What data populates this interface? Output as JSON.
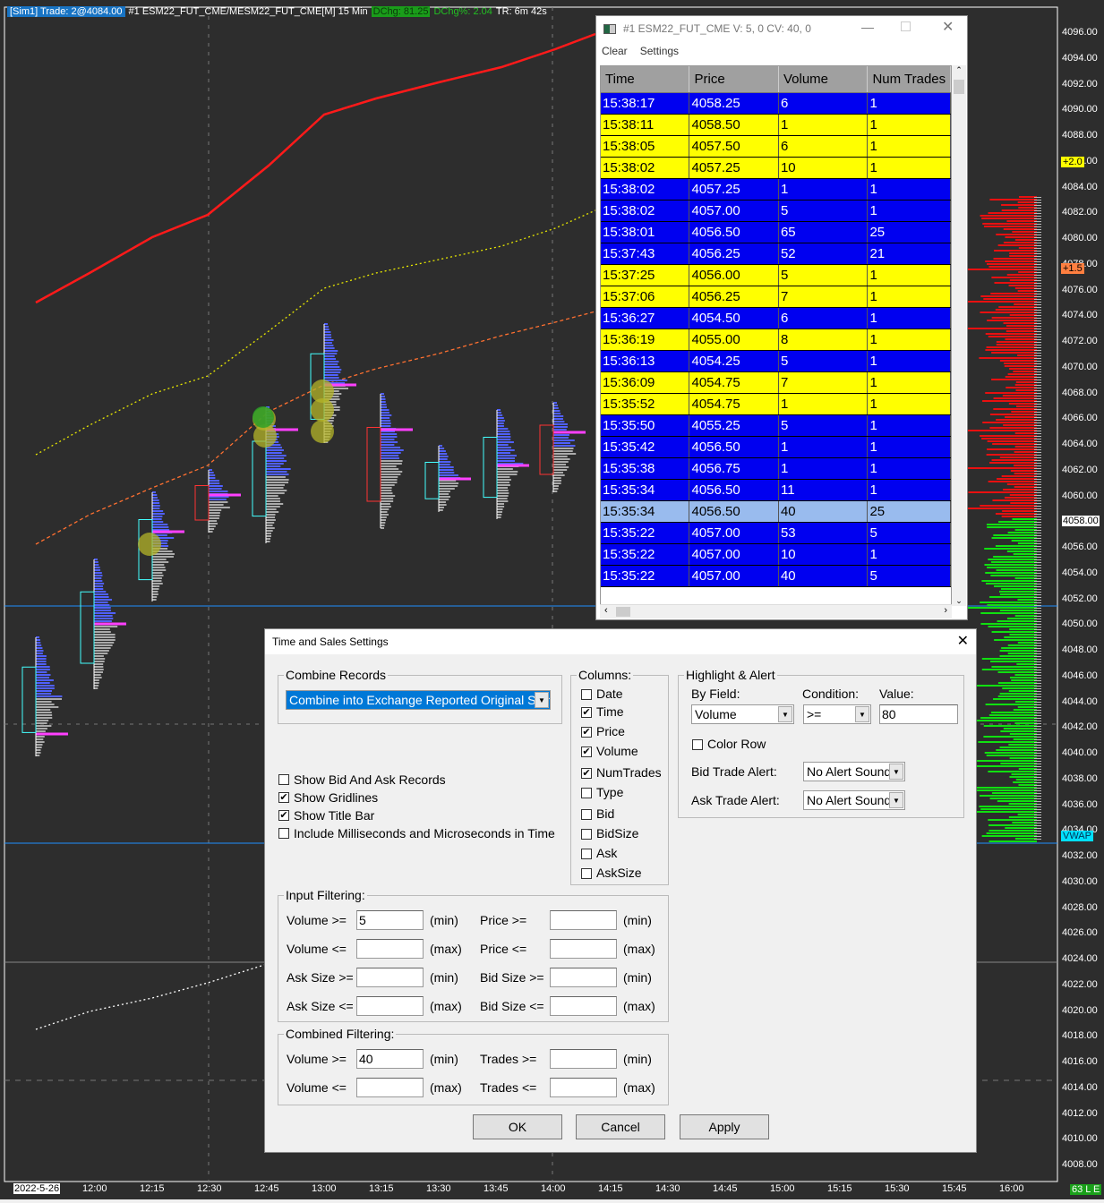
{
  "chart": {
    "header": {
      "sim": "[Sim1]  Trade: 2@4084.00",
      "symbol": "#1 ESM22_FUT_CME/MESM22_FUT_CME[M] 15 Min",
      "dchg": "DChg: 81.25",
      "dchg_pct": "DChg%: 2.04",
      "tr": "TR: 6m 42s"
    },
    "price_labels": [
      "4096.00",
      "4094.00",
      "4092.00",
      "4090.00",
      "4088.00",
      "4086.00",
      "4084.00",
      "4082.00",
      "4080.00",
      "4078.00",
      "4076.00",
      "4074.00",
      "4072.00",
      "4070.00",
      "4068.00",
      "4066.00",
      "4064.00",
      "4062.00",
      "4060.00",
      "4058.00",
      "4056.00",
      "4054.00",
      "4052.00",
      "4050.00",
      "4048.00",
      "4046.00",
      "4044.00",
      "4042.00",
      "4040.00",
      "4038.00",
      "4036.00",
      "4034.00",
      "4032.00",
      "4030.00",
      "4028.00",
      "4026.00",
      "4024.00",
      "4022.00",
      "4020.00",
      "4018.00",
      "4016.00",
      "4014.00",
      "4012.00",
      "4010.00",
      "4008.00"
    ],
    "current_price": "4058.00",
    "badges": {
      "plus2": "+2.0",
      "plus15": "+1.5",
      "vwap": "VWAP",
      "status": "63 L E"
    },
    "time_labels": [
      "2022-5-26",
      "12:00",
      "12:15",
      "12:30",
      "12:45",
      "13:00",
      "13:15",
      "13:30",
      "13:45",
      "14:00",
      "14:15",
      "14:30",
      "14:45",
      "15:00",
      "15:15",
      "15:30",
      "15:45",
      "16:00"
    ],
    "colors": {
      "bg": "#2d2d2d",
      "red": "#ff2020",
      "green": "#20e020",
      "blue": "#1874c4"
    }
  },
  "ts": {
    "title": "#1 ESM22_FUT_CME  V: 5, 0  CV: 40, 0",
    "menu": [
      "Clear",
      "Settings"
    ],
    "columns": [
      "Time",
      "Price",
      "Volume",
      "Num Trades"
    ],
    "rows": [
      {
        "t": "15:38:17",
        "p": "4058.25",
        "v": "6",
        "n": "1",
        "c": "blue"
      },
      {
        "t": "15:38:11",
        "p": "4058.50",
        "v": "1",
        "n": "1",
        "c": "yellow"
      },
      {
        "t": "15:38:05",
        "p": "4057.50",
        "v": "6",
        "n": "1",
        "c": "yellow"
      },
      {
        "t": "15:38:02",
        "p": "4057.25",
        "v": "10",
        "n": "1",
        "c": "yellow"
      },
      {
        "t": "15:38:02",
        "p": "4057.25",
        "v": "1",
        "n": "1",
        "c": "blue"
      },
      {
        "t": "15:38:02",
        "p": "4057.00",
        "v": "5",
        "n": "1",
        "c": "blue"
      },
      {
        "t": "15:38:01",
        "p": "4056.50",
        "v": "65",
        "n": "25",
        "c": "blue"
      },
      {
        "t": "15:37:43",
        "p": "4056.25",
        "v": "52",
        "n": "21",
        "c": "blue"
      },
      {
        "t": "15:37:25",
        "p": "4056.00",
        "v": "5",
        "n": "1",
        "c": "yellow"
      },
      {
        "t": "15:37:06",
        "p": "4056.25",
        "v": "7",
        "n": "1",
        "c": "yellow"
      },
      {
        "t": "15:36:27",
        "p": "4054.50",
        "v": "6",
        "n": "1",
        "c": "blue"
      },
      {
        "t": "15:36:19",
        "p": "4055.00",
        "v": "8",
        "n": "1",
        "c": "yellow"
      },
      {
        "t": "15:36:13",
        "p": "4054.25",
        "v": "5",
        "n": "1",
        "c": "blue"
      },
      {
        "t": "15:36:09",
        "p": "4054.75",
        "v": "7",
        "n": "1",
        "c": "yellow"
      },
      {
        "t": "15:35:52",
        "p": "4054.75",
        "v": "1",
        "n": "1",
        "c": "yellow"
      },
      {
        "t": "15:35:50",
        "p": "4055.25",
        "v": "5",
        "n": "1",
        "c": "blue"
      },
      {
        "t": "15:35:42",
        "p": "4056.50",
        "v": "1",
        "n": "1",
        "c": "blue"
      },
      {
        "t": "15:35:38",
        "p": "4056.75",
        "v": "1",
        "n": "1",
        "c": "blue"
      },
      {
        "t": "15:35:34",
        "p": "4056.50",
        "v": "11",
        "n": "1",
        "c": "blue"
      },
      {
        "t": "15:35:34",
        "p": "4056.50",
        "v": "40",
        "n": "25",
        "c": "sel"
      },
      {
        "t": "15:35:22",
        "p": "4057.00",
        "v": "53",
        "n": "5",
        "c": "blue"
      },
      {
        "t": "15:35:22",
        "p": "4057.00",
        "v": "10",
        "n": "1",
        "c": "blue"
      },
      {
        "t": "15:35:22",
        "p": "4057.00",
        "v": "40",
        "n": "5",
        "c": "blue"
      }
    ]
  },
  "dialog": {
    "title": "Time and Sales Settings",
    "combine": {
      "legend": "Combine Records",
      "value": "Combine into Exchange Reported Original Sum"
    },
    "options": [
      {
        "label": "Show Bid And Ask Records",
        "checked": false
      },
      {
        "label": "Show Gridlines",
        "checked": true
      },
      {
        "label": "Show Title Bar",
        "checked": true
      },
      {
        "label": "Include Milliseconds and Microseconds in Time",
        "checked": false
      }
    ],
    "columns": {
      "legend": "Columns:",
      "items": [
        {
          "label": "Date",
          "checked": false
        },
        {
          "label": "Time",
          "checked": true
        },
        {
          "label": "Price",
          "checked": true
        },
        {
          "label": "Volume",
          "checked": true
        },
        {
          "label": "NumTrades",
          "checked": true
        },
        {
          "label": "Type",
          "checked": false
        },
        {
          "label": "Bid",
          "checked": false
        },
        {
          "label": "BidSize",
          "checked": false
        },
        {
          "label": "Ask",
          "checked": false
        },
        {
          "label": "AskSize",
          "checked": false
        }
      ]
    },
    "highlight": {
      "legend": "Highlight & Alert",
      "by_field_label": "By Field:",
      "by_field": "Volume",
      "condition_label": "Condition:",
      "condition": ">=",
      "value_label": "Value:",
      "value": "80",
      "color_row": "Color Row",
      "bid_alert_label": "Bid Trade Alert:",
      "bid_alert": "No Alert Sound",
      "ask_alert_label": "Ask Trade Alert:",
      "ask_alert": "No Alert Sound"
    },
    "input_filtering": {
      "legend": "Input Filtering:",
      "rows": [
        {
          "l1": "Volume >=",
          "v1": "5",
          "u1": "(min)",
          "l2": "Price >=",
          "v2": "",
          "u2": "(min)"
        },
        {
          "l1": "Volume <=",
          "v1": "",
          "u1": "(max)",
          "l2": "Price <=",
          "v2": "",
          "u2": "(max)"
        },
        {
          "l1": "Ask Size >=",
          "v1": "",
          "u1": "(min)",
          "l2": "Bid Size >=",
          "v2": "",
          "u2": "(min)"
        },
        {
          "l1": "Ask Size <=",
          "v1": "",
          "u1": "(max)",
          "l2": "Bid Size <=",
          "v2": "",
          "u2": "(max)"
        }
      ]
    },
    "combined_filtering": {
      "legend": "Combined Filtering:",
      "rows": [
        {
          "l1": "Volume >=",
          "v1": "40",
          "u1": "(min)",
          "l2": "Trades >=",
          "v2": "",
          "u2": "(min)"
        },
        {
          "l1": "Volume <=",
          "v1": "",
          "u1": "(max)",
          "l2": "Trades <=",
          "v2": "",
          "u2": "(max)"
        }
      ]
    },
    "buttons": {
      "ok": "OK",
      "cancel": "Cancel",
      "apply": "Apply"
    }
  }
}
